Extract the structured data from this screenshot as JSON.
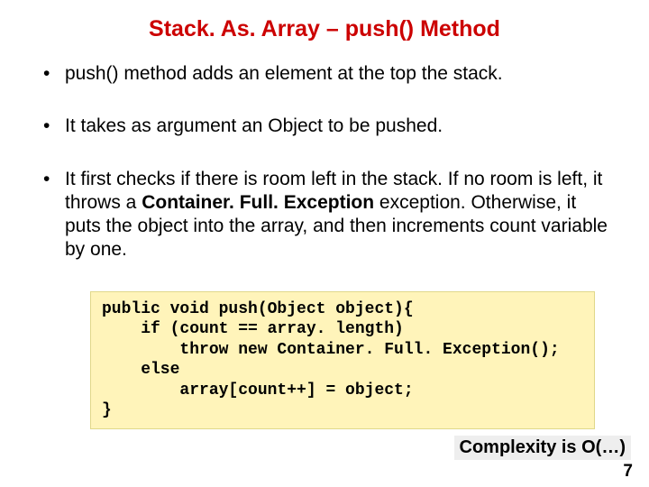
{
  "title": "Stack. As. Array – push() Method",
  "bullets": [
    {
      "text": "push() method adds an element at the top the stack."
    },
    {
      "text": "It takes as argument an Object to be pushed."
    },
    {
      "pre": "It first checks if there is room left in the stack. If no room is left, it throws a ",
      "bold": "Container. Full. Exception",
      "post": " exception. Otherwise, it puts the object into the array, and then increments count variable by one."
    }
  ],
  "code": "public void push(Object object){\n    if (count == array. length)\n        throw new Container. Full. Exception();\n    else\n        array[count++] = object;\n}",
  "complexity": "Complexity is O(…)",
  "page": "7"
}
